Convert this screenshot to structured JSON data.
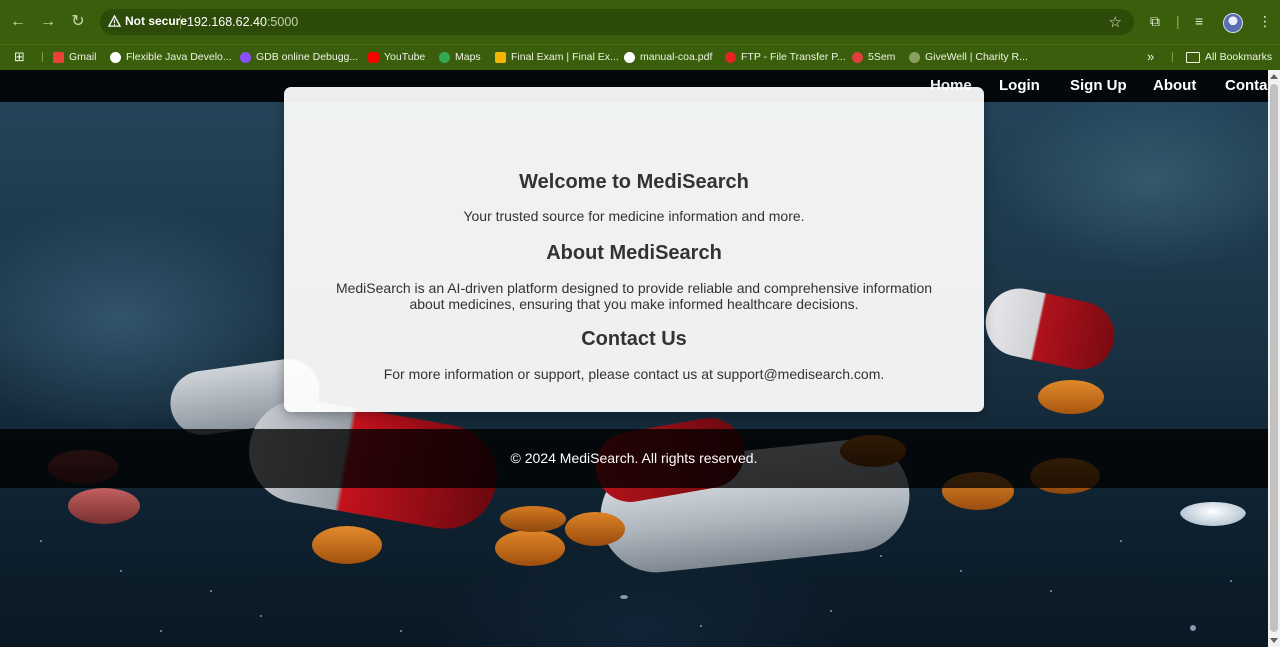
{
  "browser": {
    "security_label": "Not secure",
    "url_host": "192.168.62.40",
    "url_port": ":5000",
    "bookmarks": [
      {
        "label": "Gmail",
        "icon": "gmail-icon",
        "color": "#ea4335"
      },
      {
        "label": "Flexible Java Develo...",
        "icon": "info-icon",
        "color": "#ffffff"
      },
      {
        "label": "GDB online Debugg...",
        "icon": "gdb-icon",
        "color": "#8a4fff"
      },
      {
        "label": "YouTube",
        "icon": "youtube-icon",
        "color": "#ff0000"
      },
      {
        "label": "Maps",
        "icon": "maps-icon",
        "color": "#34a853"
      },
      {
        "label": "Final Exam | Final Ex...",
        "icon": "exam-icon",
        "color": "#f4b400"
      },
      {
        "label": "manual-coa.pdf",
        "icon": "globe-icon",
        "color": "#ffffff"
      },
      {
        "label": "FTP - File Transfer P...",
        "icon": "heart-icon",
        "color": "#e52222"
      },
      {
        "label": "5Sem",
        "icon": "5sem-icon",
        "color": "#e04040"
      },
      {
        "label": "GiveWell | Charity R...",
        "icon": "givewell-icon",
        "color": "#8aa060"
      }
    ],
    "all_bookmarks_label": "All Bookmarks"
  },
  "nav": {
    "home": "Home",
    "login": "Login",
    "signup": "Sign Up",
    "about": "About",
    "contact": "Contac"
  },
  "card": {
    "welcome_title": "Welcome to MediSearch",
    "welcome_text": "Your trusted source for medicine information and more.",
    "about_title": "About MediSearch",
    "about_text": "MediSearch is an AI-driven platform designed to provide reliable and comprehensive information about medicines, ensuring that you make informed healthcare decisions.",
    "contact_title": "Contact Us",
    "contact_text": "For more information or support, please contact us at support@medisearch.com."
  },
  "footer": {
    "text": "© 2024 MediSearch. All rights reserved."
  },
  "colors": {
    "chrome": "#3a5e0c",
    "nav_bg": "#000000",
    "card_bg": "#ffffff",
    "accent_pill_red": "#c4121c",
    "tablet_orange": "#d9781c"
  }
}
